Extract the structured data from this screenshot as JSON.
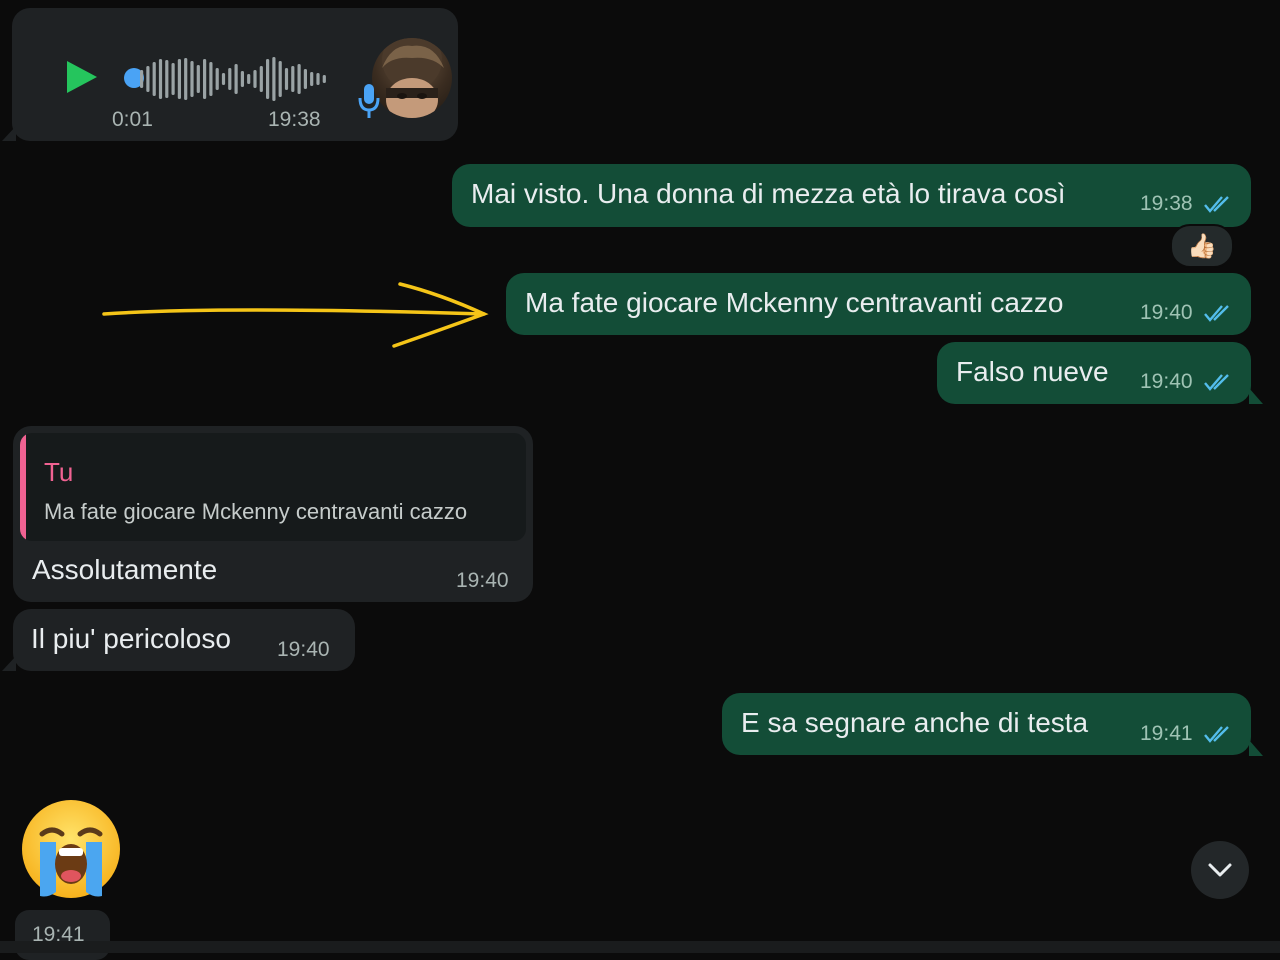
{
  "colors": {
    "background": "#0b0b0b",
    "incoming_bubble": "#1f2224",
    "outgoing_bubble": "#134d37",
    "read_ticks": "#53bdeb",
    "reply_accent": "#f06292",
    "play_button": "#25c55d",
    "annotation_arrow": "#f5c518"
  },
  "voice_message": {
    "duration": "0:01",
    "time": "19:38",
    "play_icon": "play-icon",
    "mic_icon": "microphone-icon",
    "playback_progress": 0
  },
  "messages": {
    "m1": {
      "text": "Mai visto. Una donna di mezza età lo tirava così",
      "time": "19:38",
      "reaction": "👍🏻"
    },
    "m2": {
      "text": "Ma fate giocare Mckenny centravanti cazzo",
      "time": "19:40"
    },
    "m3": {
      "text": "Falso nueve",
      "time": "19:40"
    },
    "m4": {
      "quote_author": "Tu",
      "quote_text": "Ma fate giocare Mckenny centravanti cazzo",
      "text": "Assolutamente",
      "time": "19:40"
    },
    "m5": {
      "text": "Il piu' pericoloso",
      "time": "19:40"
    },
    "m6": {
      "text": "E sa segnare anche di testa",
      "time": "19:41"
    },
    "m7": {
      "emoji": "loudly-crying-face",
      "time": "19:41"
    }
  },
  "scroll_button": {
    "icon": "chevron-down-icon"
  }
}
